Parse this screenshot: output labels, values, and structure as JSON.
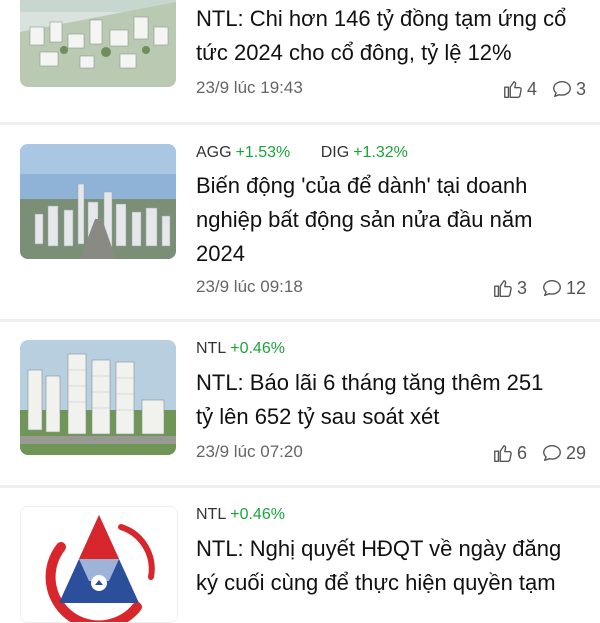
{
  "feed": {
    "items": [
      {
        "tickers": [],
        "title_lines": [
          "NTL: Chi hơn 146 tỷ đồng tạm ứng cổ",
          "tức 2024 cho cổ đông, tỷ lệ 12%"
        ],
        "time": "23/9 lúc 19:43",
        "likes": "4",
        "comments": "3",
        "thumb_icon": "aerial-city-render-image"
      },
      {
        "tickers": [
          {
            "symbol": "AGG",
            "change": "+1.53%"
          },
          {
            "symbol": "DIG",
            "change": "+1.32%"
          }
        ],
        "title_lines": [
          "Biến động 'của để dành' tại doanh",
          "nghiệp bất động sản nửa đầu năm",
          "2024"
        ],
        "time": "23/9 lúc 09:18",
        "likes": "3",
        "comments": "12",
        "thumb_icon": "city-skyline-photo-image"
      },
      {
        "tickers": [
          {
            "symbol": "NTL",
            "change": "+0.46%"
          }
        ],
        "title_lines": [
          "NTL: Báo lãi 6 tháng tăng thêm 251",
          "tỷ lên 652 tỷ sau soát xét"
        ],
        "time": "23/9 lúc 07:20",
        "likes": "6",
        "comments": "29",
        "thumb_icon": "apartment-towers-render-image"
      },
      {
        "tickers": [
          {
            "symbol": "NTL",
            "change": "+0.46%"
          }
        ],
        "title_lines": [
          "NTL: Nghị quyết HĐQT về ngày đăng",
          "ký cuối cùng để thực hiện quyền tạm"
        ],
        "thumb_icon": "company-logo-image"
      }
    ]
  },
  "colors": {
    "positive": "#1aa33a",
    "text": "#111111",
    "muted": "#666666",
    "divider": "#efefef"
  }
}
